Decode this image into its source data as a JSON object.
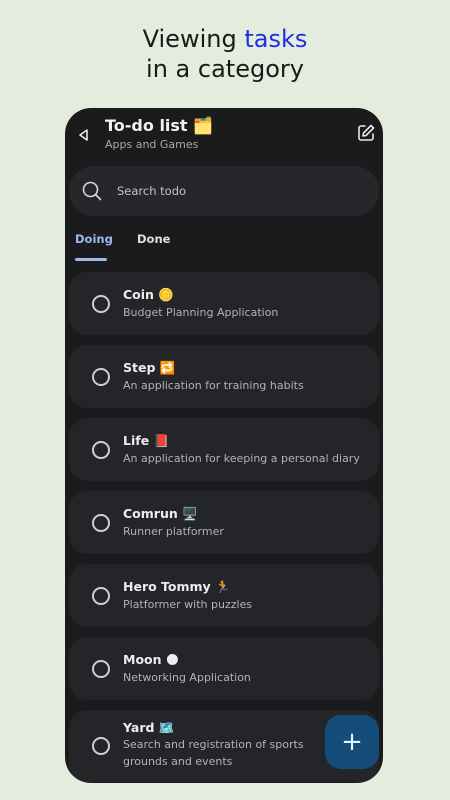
{
  "headline": {
    "line1_pre": "Viewing ",
    "line1_accent": "tasks",
    "line2": "in a category"
  },
  "topbar": {
    "title": "To-do list 🗂️",
    "subtitle": "Apps and Games",
    "back_icon": "back-arrow-icon",
    "edit_icon": "edit-note-icon"
  },
  "search": {
    "placeholder": "Search todo",
    "value": ""
  },
  "tabs": [
    {
      "label": "Doing",
      "active": true
    },
    {
      "label": "Done",
      "active": false
    }
  ],
  "tasks": [
    {
      "title": "Coin 🪙",
      "subtitle": "Budget Planning Application",
      "done": false
    },
    {
      "title": "Step 🔁",
      "subtitle": "An application for training habits",
      "done": false
    },
    {
      "title": "Life 📕",
      "subtitle": "An application for keeping a personal diary",
      "done": false
    },
    {
      "title": "Comrun 🖥️",
      "subtitle": "Runner platformer",
      "done": false
    },
    {
      "title": "Hero Tommy 🏃",
      "subtitle": "Platformer with puzzles",
      "done": false
    },
    {
      "title": "Moon 🌑",
      "subtitle": "Networking Application",
      "done": false
    },
    {
      "title": "Yard 🗺️",
      "subtitle": "Search and registration of sports grounds and events",
      "done": false
    }
  ],
  "fab": {
    "label": "+",
    "icon": "plus-icon"
  },
  "colors": {
    "background": "#e3ecdd",
    "accent_headline": "#1d2fe0",
    "surface": "#1b1b1d",
    "card": "#242528",
    "tab_active": "#9bbcec",
    "fab": "#144d7a"
  }
}
